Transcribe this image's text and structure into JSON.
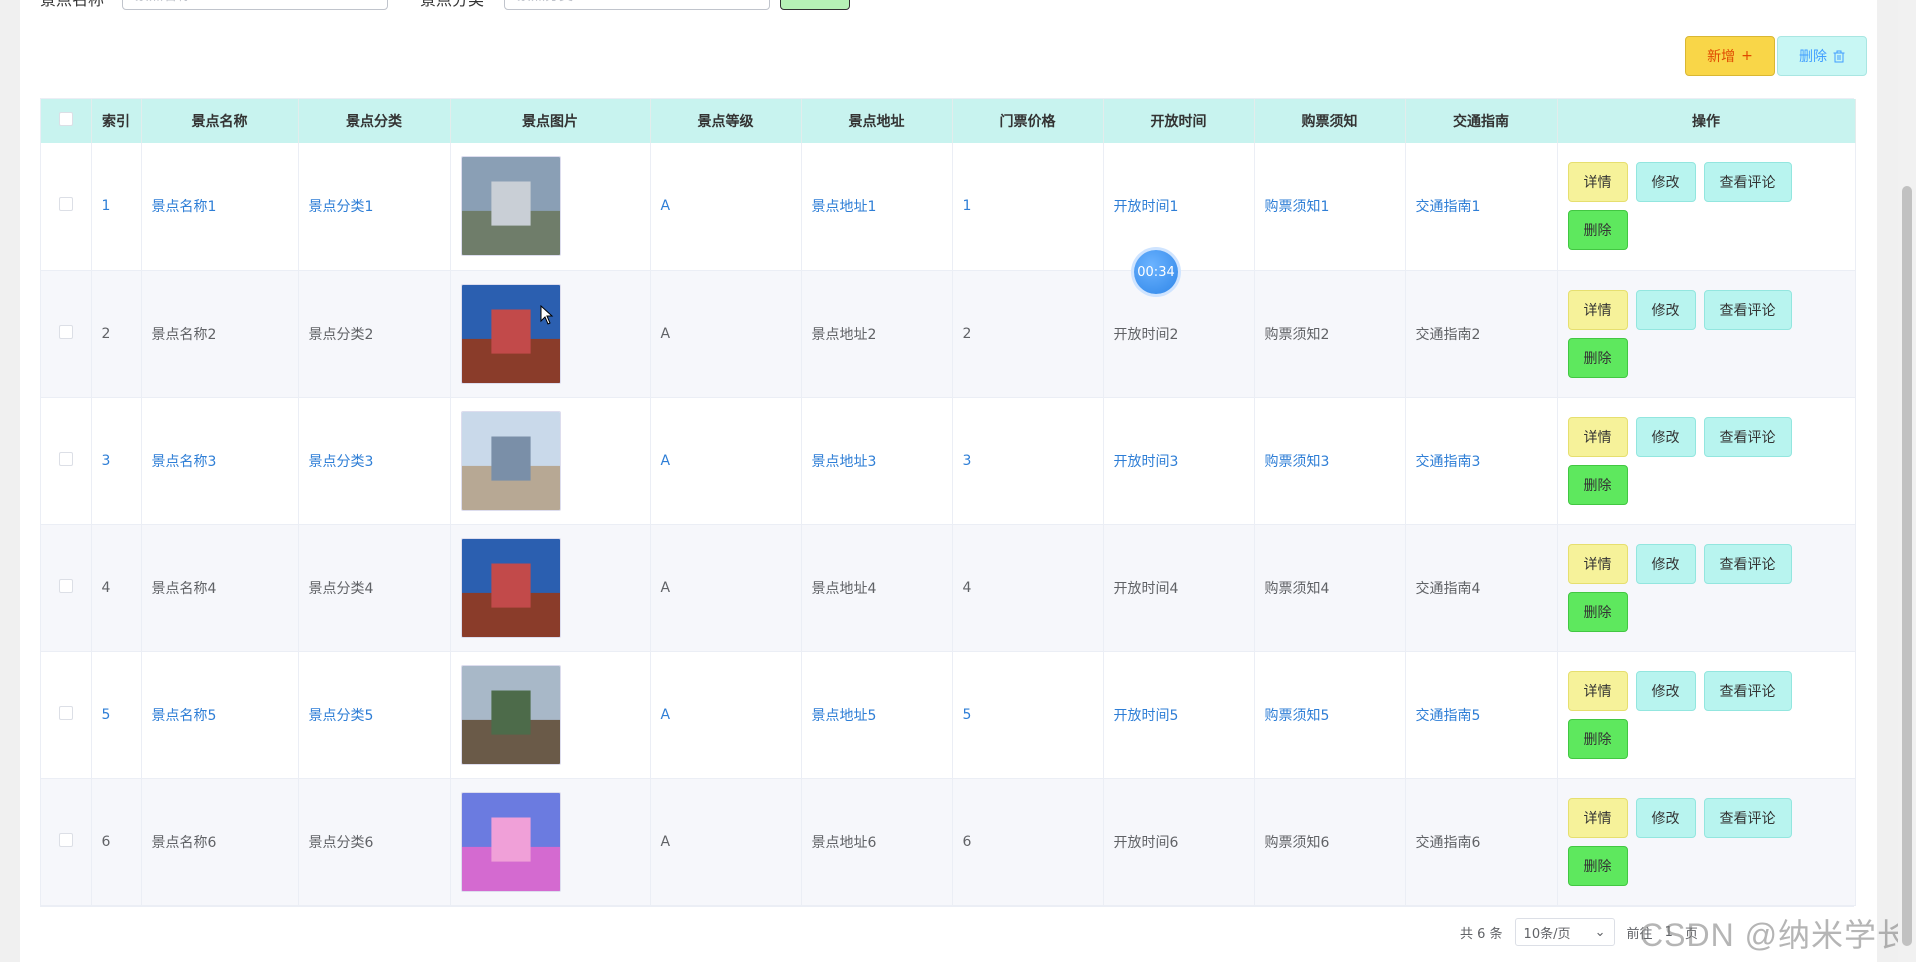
{
  "search": {
    "name_label": "景点名称",
    "name_placeholder": "景点名称",
    "type_label": "景点分类",
    "type_placeholder": "景点分类"
  },
  "toolbar": {
    "add_label": "新增",
    "add_icon": "+",
    "delete_label": "删除",
    "delete_icon": "trash-icon"
  },
  "table": {
    "headers": [
      "",
      "索引",
      "景点名称",
      "景点分类",
      "景点图片",
      "景点等级",
      "景点地址",
      "门票价格",
      "开放时间",
      "购票须知",
      "交通指南",
      "操作"
    ],
    "rows": [
      {
        "index": "1",
        "name": "景点名称1",
        "type": "景点分类1",
        "level": "A",
        "address": "景点地址1",
        "price": "1",
        "open": "开放时间1",
        "notice": "购票须知1",
        "traffic": "交通指南1"
      },
      {
        "index": "2",
        "name": "景点名称2",
        "type": "景点分类2",
        "level": "A",
        "address": "景点地址2",
        "price": "2",
        "open": "开放时间2",
        "notice": "购票须知2",
        "traffic": "交通指南2"
      },
      {
        "index": "3",
        "name": "景点名称3",
        "type": "景点分类3",
        "level": "A",
        "address": "景点地址3",
        "price": "3",
        "open": "开放时间3",
        "notice": "购票须知3",
        "traffic": "交通指南3"
      },
      {
        "index": "4",
        "name": "景点名称4",
        "type": "景点分类4",
        "level": "A",
        "address": "景点地址4",
        "price": "4",
        "open": "开放时间4",
        "notice": "购票须知4",
        "traffic": "交通指南4"
      },
      {
        "index": "5",
        "name": "景点名称5",
        "type": "景点分类5",
        "level": "A",
        "address": "景点地址5",
        "price": "5",
        "open": "开放时间5",
        "notice": "购票须知5",
        "traffic": "交通指南5"
      },
      {
        "index": "6",
        "name": "景点名称6",
        "type": "景点分类6",
        "level": "A",
        "address": "景点地址6",
        "price": "6",
        "open": "开放时间6",
        "notice": "购票须知6",
        "traffic": "交通指南6"
      }
    ],
    "ops": {
      "detail": "详情",
      "edit": "修改",
      "comment": "查看评论",
      "delete": "删除"
    }
  },
  "timer": "00:34",
  "pager": {
    "total": "共 6 条",
    "page_size": "10条/页",
    "goto": "前往",
    "page": "1",
    "page_unit": "页"
  },
  "watermark": "CSDN @纳米学长",
  "colors": {
    "header_bg": "#c8f3ef",
    "add_btn": "#f9d648",
    "delete_btn": "#5ee85e",
    "link": "#2e7ed6"
  }
}
